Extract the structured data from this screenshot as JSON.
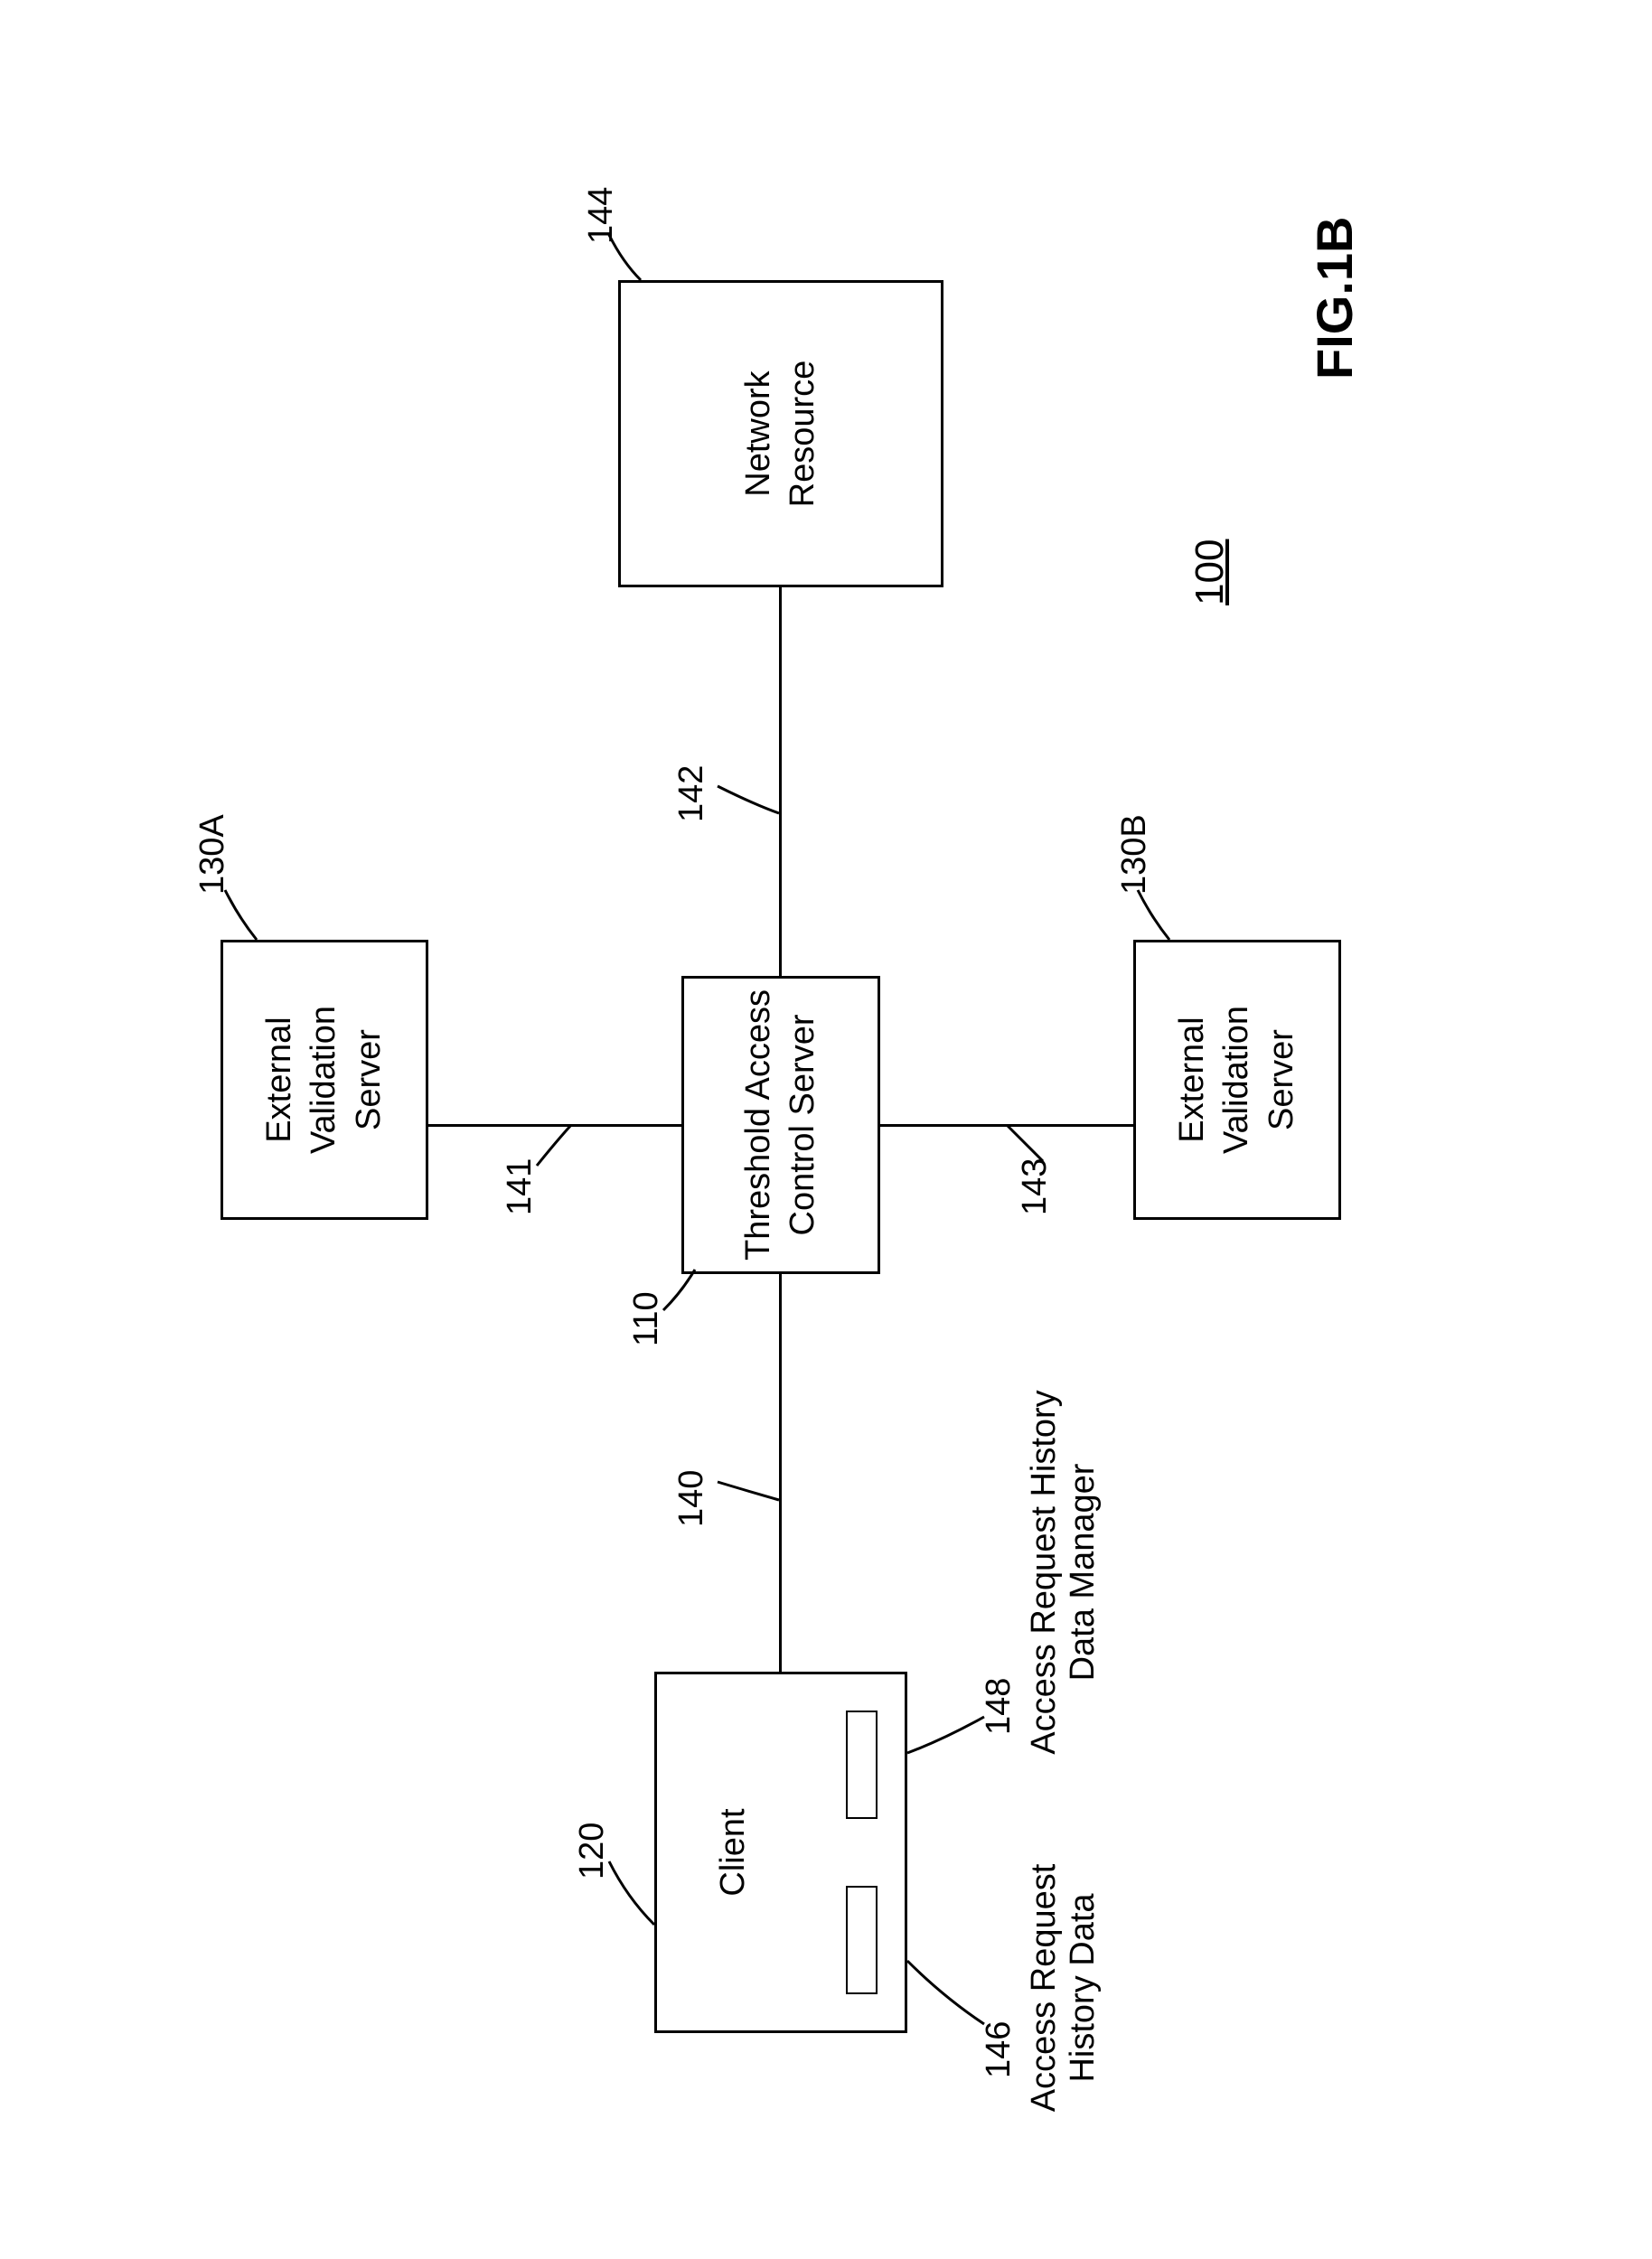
{
  "boxes": {
    "client": {
      "label": "Client",
      "ref": "120"
    },
    "tacs": {
      "label": "Threshold Access\nControl Server",
      "ref": "110"
    },
    "network_resource": {
      "label": "Network\nResource",
      "ref": "144"
    },
    "ext_val_a": {
      "label": "External\nValidation\nServer",
      "ref": "130A"
    },
    "ext_val_b": {
      "label": "External\nValidation\nServer",
      "ref": "130B"
    }
  },
  "links": {
    "client_tacs": "140",
    "tacs_ext_a": "141",
    "tacs_resource": "142",
    "tacs_ext_b": "143"
  },
  "client_internals": {
    "history_data": {
      "label": "Access Request\nHistory Data",
      "ref": "146"
    },
    "data_manager": {
      "label": "Access Request History\nData Manager",
      "ref": "148"
    }
  },
  "system_ref": "100",
  "figure_label": "FIG.1B"
}
